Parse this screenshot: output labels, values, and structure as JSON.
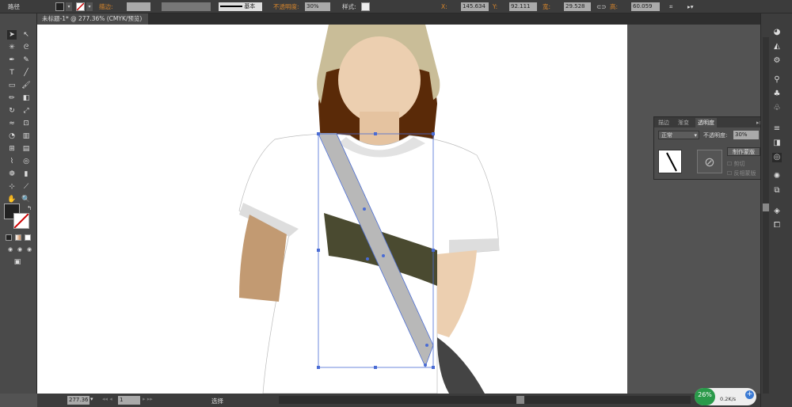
{
  "control_bar": {
    "object_type": "路径",
    "stroke_label": "描边:",
    "stroke_profile": "基本",
    "opacity_label": "不透明度:",
    "opacity_value": "30%",
    "style_label": "样式:",
    "x_label": "X:",
    "x_value": "145.634 m",
    "y_label": "Y:",
    "y_value": "92.111 mm",
    "width_label": "宽:",
    "width_value": "29.528 mm",
    "height_label": "高:",
    "height_value": "60.059 mm"
  },
  "document_tab": {
    "title": "未标题-1* @ 277.36% (CMYK/预览)",
    "close": "×"
  },
  "transparency_panel": {
    "tabs": [
      "描边",
      "渐变",
      "透明度"
    ],
    "blend_mode": "正常",
    "opacity_label": "不透明度:",
    "opacity_value": "30%",
    "make_mask_button": "制作蒙版",
    "clip_label": "剪切",
    "invert_mask_label": "反相蒙版"
  },
  "status_bar": {
    "zoom": "277.36",
    "artboard": "1",
    "tool": "选择"
  },
  "network_widget": {
    "percent": "26%",
    "speed": "0.2K/s"
  },
  "colors": {
    "accent_orange": "#d8862b",
    "shirt_strap": "#4a4a30",
    "strap_gray": "#b8b8b8",
    "selection": "#4a6cd4"
  }
}
